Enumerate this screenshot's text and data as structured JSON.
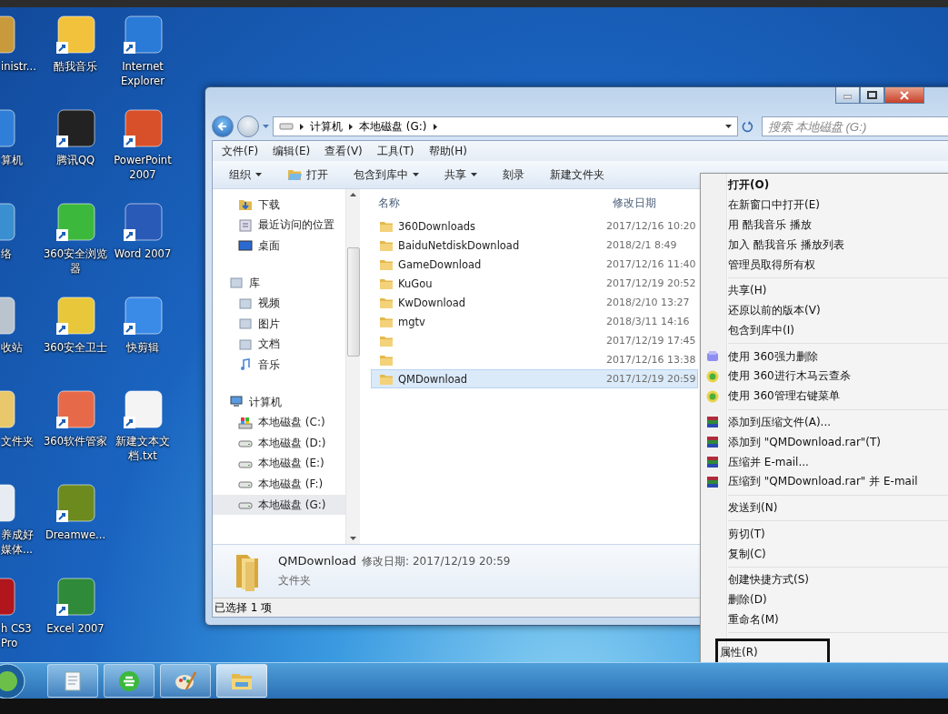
{
  "desktop_icons": [
    {
      "lines": [
        "inistr..."
      ],
      "color": "#c99a3c"
    },
    {
      "lines": [
        "算机"
      ],
      "color": "#2f7fd8"
    },
    {
      "lines": [
        "络"
      ],
      "color": "#3a8fd0"
    },
    {
      "lines": [
        "收站"
      ],
      "color": "#b9c4cf"
    },
    {
      "lines": [
        "文件夹"
      ],
      "color": "#e8c86a"
    },
    {
      "lines": [
        "养成好",
        "媒体..."
      ],
      "color": "#e6ecf2"
    },
    {
      "lines": [
        "h CS3",
        "Pro"
      ],
      "color": "#b0161c"
    },
    {
      "lines": [
        "酷我音乐"
      ],
      "color": "#f3c23c"
    },
    {
      "lines": [
        "腾讯QQ"
      ],
      "color": "#222222"
    },
    {
      "lines": [
        "360安全浏览",
        "器"
      ],
      "color": "#3cb83c"
    },
    {
      "lines": [
        "360安全卫士"
      ],
      "color": "#e8c83a"
    },
    {
      "lines": [
        "360软件管家"
      ],
      "color": "#e66a4a"
    },
    {
      "lines": [
        "Dreamwe..."
      ],
      "color": "#6c8a1e"
    },
    {
      "lines": [
        "Excel 2007"
      ],
      "color": "#2f8a3a"
    },
    {
      "lines": [
        "Internet",
        "Explorer"
      ],
      "color": "#2a7ad8"
    },
    {
      "lines": [
        "PowerPoint",
        "2007"
      ],
      "color": "#d8502a"
    },
    {
      "lines": [
        "Word 2007"
      ],
      "color": "#2a5ab8"
    },
    {
      "lines": [
        "快剪辑"
      ],
      "color": "#3a8ae8"
    },
    {
      "lines": [
        "新建文本文",
        "档.txt"
      ],
      "color": "#f4f4f4"
    }
  ],
  "explorer": {
    "breadcrumb": [
      "计算机",
      "本地磁盘 (G:)"
    ],
    "search": {
      "placeholder": "搜索 本地磁盘 (G:)"
    },
    "menu_bar": [
      "文件(F)",
      "编辑(E)",
      "查看(V)",
      "工具(T)",
      "帮助(H)"
    ],
    "toolbar": [
      {
        "label": "组织",
        "kind": "dropdown"
      },
      {
        "label": "打开",
        "kind": "open"
      },
      {
        "label": "包含到库中",
        "kind": "dropdown"
      },
      {
        "label": "共享",
        "kind": "dropdown"
      },
      {
        "label": "刻录",
        "kind": "plain"
      },
      {
        "label": "新建文件夹",
        "kind": "plain"
      }
    ],
    "nav": [
      {
        "label": "下载",
        "kind": "folder",
        "selected": false
      },
      {
        "label": "最近访问的位置",
        "kind": "recent",
        "selected": false
      },
      {
        "label": "桌面",
        "kind": "desktop",
        "selected": false
      },
      {
        "label": "库",
        "kind": "library",
        "selected": false,
        "children": [
          {
            "label": "视频",
            "kind": "library",
            "selected": false
          },
          {
            "label": "图片",
            "kind": "library",
            "selected": false
          },
          {
            "label": "文档",
            "kind": "library",
            "selected": false
          },
          {
            "label": "音乐",
            "kind": "music",
            "selected": false
          }
        ]
      },
      {
        "label": "计算机",
        "kind": "computer",
        "selected": false,
        "children": [
          {
            "label": "本地磁盘 (C:)",
            "kind": "system",
            "selected": false
          },
          {
            "label": "本地磁盘 (D:)",
            "kind": "drive",
            "selected": false
          },
          {
            "label": "本地磁盘 (E:)",
            "kind": "drive",
            "selected": false
          },
          {
            "label": "本地磁盘 (F:)",
            "kind": "drive",
            "selected": false
          },
          {
            "label": "本地磁盘 (G:)",
            "kind": "drive",
            "selected": true
          }
        ]
      }
    ],
    "columns": [
      "名称",
      "修改日期"
    ],
    "rows": [
      {
        "name": "360Downloads",
        "date": "2017/12/16 10:20",
        "selected": false
      },
      {
        "name": "BaiduNetdiskDownload",
        "date": "2018/2/1 8:49",
        "selected": false
      },
      {
        "name": "GameDownload",
        "date": "2017/12/16 11:40",
        "selected": false
      },
      {
        "name": "KuGou",
        "date": "2017/12/19 20:52",
        "selected": false
      },
      {
        "name": "KwDownload",
        "date": "2018/2/10 13:27",
        "selected": false
      },
      {
        "name": "mgtv",
        "date": "2018/3/11 14:16",
        "selected": false
      },
      {
        "date": "2017/12/19 17:45",
        "selected": false
      },
      {
        "date": "2017/12/16 13:38",
        "selected": false
      },
      {
        "name": "QMDownload",
        "date": "2017/12/19 20:59",
        "selected": true
      }
    ],
    "details": {
      "name": "QMDownload",
      "modified": "修改日期: 2017/12/19 20:59",
      "type": "文件夹"
    },
    "status_bar": "已选择 1 项"
  },
  "context_menu": [
    {
      "kind": "item",
      "label": "打开(O)",
      "default": true,
      "highlighted": false
    },
    {
      "kind": "item",
      "label": "在新窗口中打开(E)",
      "default": false,
      "highlighted": false
    },
    {
      "kind": "item",
      "label": "用 酷我音乐 播放",
      "default": false,
      "highlighted": false
    },
    {
      "kind": "item",
      "label": "加入 酷我音乐 播放列表",
      "default": false,
      "highlighted": false
    },
    {
      "kind": "item",
      "label": "管理员取得所有权",
      "default": false,
      "highlighted": false
    },
    {
      "kind": "separator"
    },
    {
      "kind": "item",
      "label": "共享(H)",
      "default": false,
      "highlighted": false
    },
    {
      "kind": "item",
      "label": "还原以前的版本(V)",
      "default": false,
      "highlighted": false
    },
    {
      "kind": "item",
      "label": "包含到库中(I)",
      "default": false,
      "highlighted": false
    },
    {
      "kind": "separator"
    },
    {
      "kind": "shred",
      "label": "使用 360强力删除",
      "default": false,
      "highlighted": false
    },
    {
      "kind": "scan",
      "label": "使用 360进行木马云查杀",
      "default": false,
      "highlighted": false
    },
    {
      "kind": "scan",
      "label": "使用 360管理右键菜单",
      "default": false,
      "highlighted": false
    },
    {
      "kind": "separator"
    },
    {
      "kind": "archive",
      "label": "添加到压缩文件(A)...",
      "default": false,
      "highlighted": false
    },
    {
      "kind": "archive",
      "label": "添加到 \"QMDownload.rar\"(T)",
      "default": false,
      "highlighted": false
    },
    {
      "kind": "archive",
      "label": "压缩并 E-mail...",
      "default": false,
      "highlighted": false
    },
    {
      "kind": "archive",
      "label": "压缩到 \"QMDownload.rar\" 并 E-mail",
      "default": false,
      "highlighted": false
    },
    {
      "kind": "separator"
    },
    {
      "kind": "item",
      "label": "发送到(N)",
      "default": false,
      "highlighted": false
    },
    {
      "kind": "separator"
    },
    {
      "kind": "item",
      "label": "剪切(T)",
      "default": false,
      "highlighted": false
    },
    {
      "kind": "item",
      "label": "复制(C)",
      "default": false,
      "highlighted": false
    },
    {
      "kind": "separator"
    },
    {
      "kind": "item",
      "label": "创建快捷方式(S)",
      "default": false,
      "highlighted": false
    },
    {
      "kind": "item",
      "label": "删除(D)",
      "default": false,
      "highlighted": false
    },
    {
      "kind": "item",
      "label": "重命名(M)",
      "default": false,
      "highlighted": false
    },
    {
      "kind": "separator"
    },
    {
      "kind": "item",
      "label": "属性(R)",
      "default": false,
      "highlighted": true
    }
  ],
  "taskbar": [
    {
      "kind": "notepad",
      "active": false
    },
    {
      "kind": "browser",
      "active": false
    },
    {
      "kind": "paint",
      "active": false
    },
    {
      "kind": "explorer",
      "active": true
    }
  ]
}
